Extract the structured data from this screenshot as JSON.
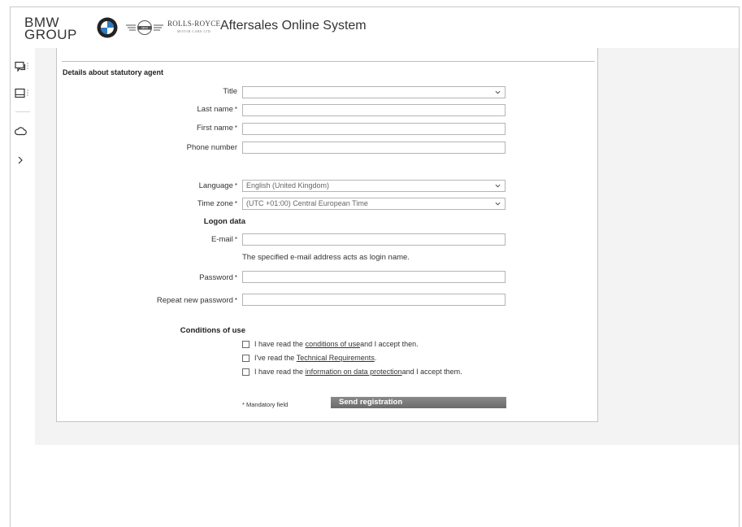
{
  "header": {
    "brand_line1": "BMW",
    "brand_line2": "GROUP",
    "rr_name": "ROLLS-ROYCE",
    "rr_sub": "MOTOR CARS LTD",
    "app_title": "Aftersales Online System",
    "icons": [
      "bmw-roundel",
      "mini-logo"
    ]
  },
  "sidebar": {
    "icons": [
      "chat-icon",
      "tablet-icon",
      "cloud-icon",
      "chevron-right-icon"
    ]
  },
  "form": {
    "section_title": "Details about statutory agent",
    "title_label": "Title",
    "title_value": "",
    "last_name_label": "Last name",
    "first_name_label": "First name",
    "phone_label": "Phone number",
    "language_label": "Language",
    "language_value": "English (United Kingdom)",
    "timezone_label": "Time zone",
    "timezone_value": "(UTC +01:00) Central European Time",
    "logon_heading": "Logon data",
    "email_label": "E-mail",
    "email_hint": "The specified e-mail address acts as login name.",
    "password_label": "Password",
    "repeat_password_label": "Repeat new password",
    "required_marker": "*",
    "conditions_heading": "Conditions of use",
    "cb1_pre": "I have read the ",
    "cb1_link": "conditions of use ",
    "cb1_post": "and I accept then.",
    "cb2_pre": "I've read the ",
    "cb2_link": "Technical Requirements",
    "cb2_post": ".",
    "cb3_pre": "I have read the ",
    "cb3_link": "information on data protection ",
    "cb3_post": "and I accept them.",
    "mandatory_note": "* Mandatory field",
    "send_button": "Send registration"
  }
}
